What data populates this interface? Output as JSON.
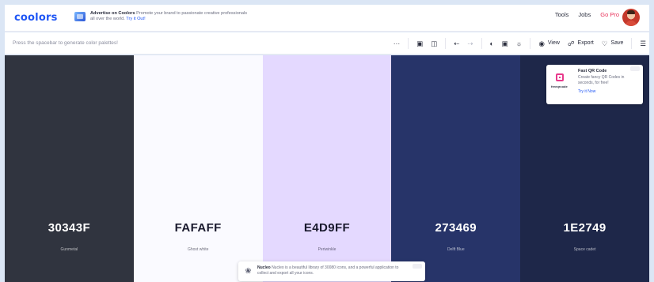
{
  "brand": {
    "logo": "coolors",
    "accent": "#1f56f5"
  },
  "top_ad": {
    "title": "Advertise on Coolors",
    "body": "Promote your brand to passionate creative professionals all over the world.",
    "cta": "Try it Out!"
  },
  "nav": {
    "tools": "Tools",
    "jobs": "Jobs",
    "go_pro": "Go Pro"
  },
  "toolbar": {
    "hint": "Press the spacebar to generate color palettes!",
    "more": "···",
    "view": "View",
    "export": "Export",
    "save": "Save"
  },
  "palette": [
    {
      "hex": "30343F",
      "name": "Gunmetal",
      "color": "#30343f",
      "text_color": "#ffffff"
    },
    {
      "hex": "FAFAFF",
      "name": "Ghost white",
      "color": "#fafaff",
      "text_color": "#1a1a2e"
    },
    {
      "hex": "E4D9FF",
      "name": "Periwinkle",
      "color": "#e4d9ff",
      "text_color": "#1a1a2e"
    },
    {
      "hex": "273469",
      "name": "Delft Blue",
      "color": "#273469",
      "text_color": "#ffffff"
    },
    {
      "hex": "1E2749",
      "name": "Space cadet",
      "color": "#1e2749",
      "text_color": "#ffffff"
    }
  ],
  "right_ad": {
    "brand": "freeqrcode",
    "title": "Fast QR Code",
    "body": "Create fancy QR Codes in seconds, for free!",
    "cta": "Try it Now"
  },
  "bottom_ad": {
    "title": "Nucleo",
    "body": "Nucleo is a beautiful library of 30080 icons, and a powerful application to collect and export all your icons."
  }
}
